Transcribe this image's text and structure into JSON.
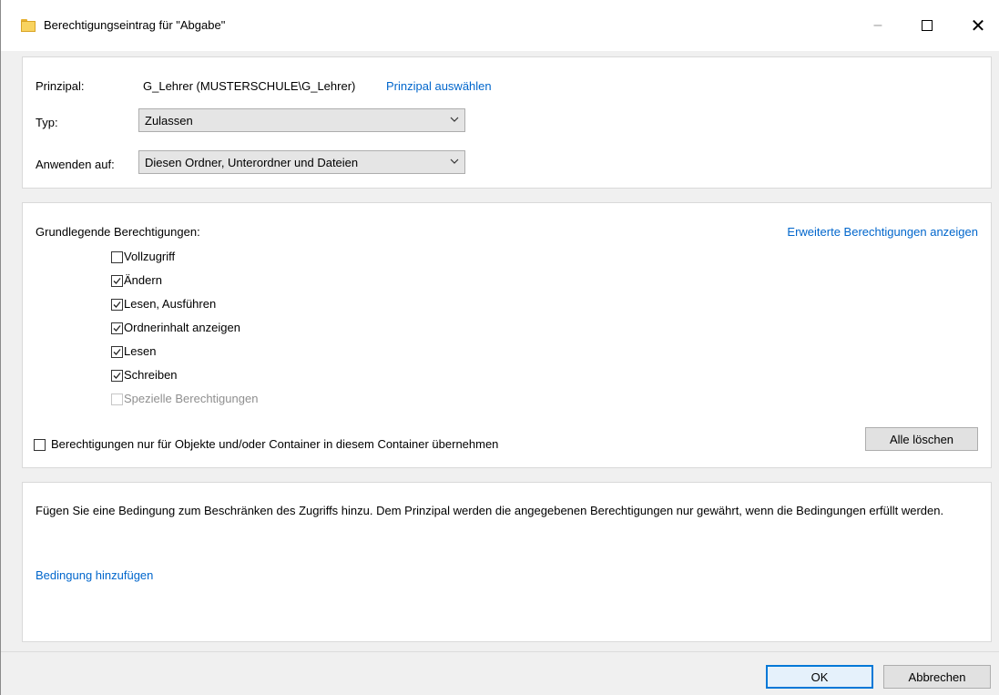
{
  "window": {
    "title": "Berechtigungseintrag für \"Abgabe\"",
    "icon": "folder-icon",
    "controls": {
      "minimize": "–",
      "close": "✕"
    }
  },
  "principal": {
    "label": "Prinzipal:",
    "value": "G_Lehrer (MUSTERSCHULE\\G_Lehrer)",
    "select_link": "Prinzipal auswählen"
  },
  "type": {
    "label": "Typ:",
    "value": "Zulassen"
  },
  "apply": {
    "label": "Anwenden auf:",
    "value": "Diesen Ordner, Unterordner und Dateien"
  },
  "permissions": {
    "header": "Grundlegende Berechtigungen:",
    "advanced_link": "Erweiterte Berechtigungen anzeigen",
    "items": [
      {
        "label": "Vollzugriff",
        "checked": false,
        "disabled": false
      },
      {
        "label": "Ändern",
        "checked": true,
        "disabled": false
      },
      {
        "label": "Lesen, Ausführen",
        "checked": true,
        "disabled": false
      },
      {
        "label": "Ordnerinhalt anzeigen",
        "checked": true,
        "disabled": false
      },
      {
        "label": "Lesen",
        "checked": true,
        "disabled": false
      },
      {
        "label": "Schreiben",
        "checked": true,
        "disabled": false
      },
      {
        "label": "Spezielle Berechtigungen",
        "checked": false,
        "disabled": true
      }
    ],
    "inherit_checkbox": {
      "label": "Berechtigungen nur für Objekte und/oder Container in diesem Container übernehmen",
      "checked": false
    },
    "clear_all_button": "Alle löschen"
  },
  "condition": {
    "text": "Fügen Sie eine Bedingung zum Beschränken des Zugriffs hinzu. Dem Prinzipal werden die angegebenen Berechtigungen nur gewährt, wenn die Bedingungen erfüllt werden.",
    "add_link": "Bedingung hinzufügen"
  },
  "footer": {
    "ok": "OK",
    "cancel": "Abbrechen"
  },
  "colors": {
    "link": "#0066cc",
    "accent": "#0078d7",
    "background": "#f0f0f0"
  }
}
